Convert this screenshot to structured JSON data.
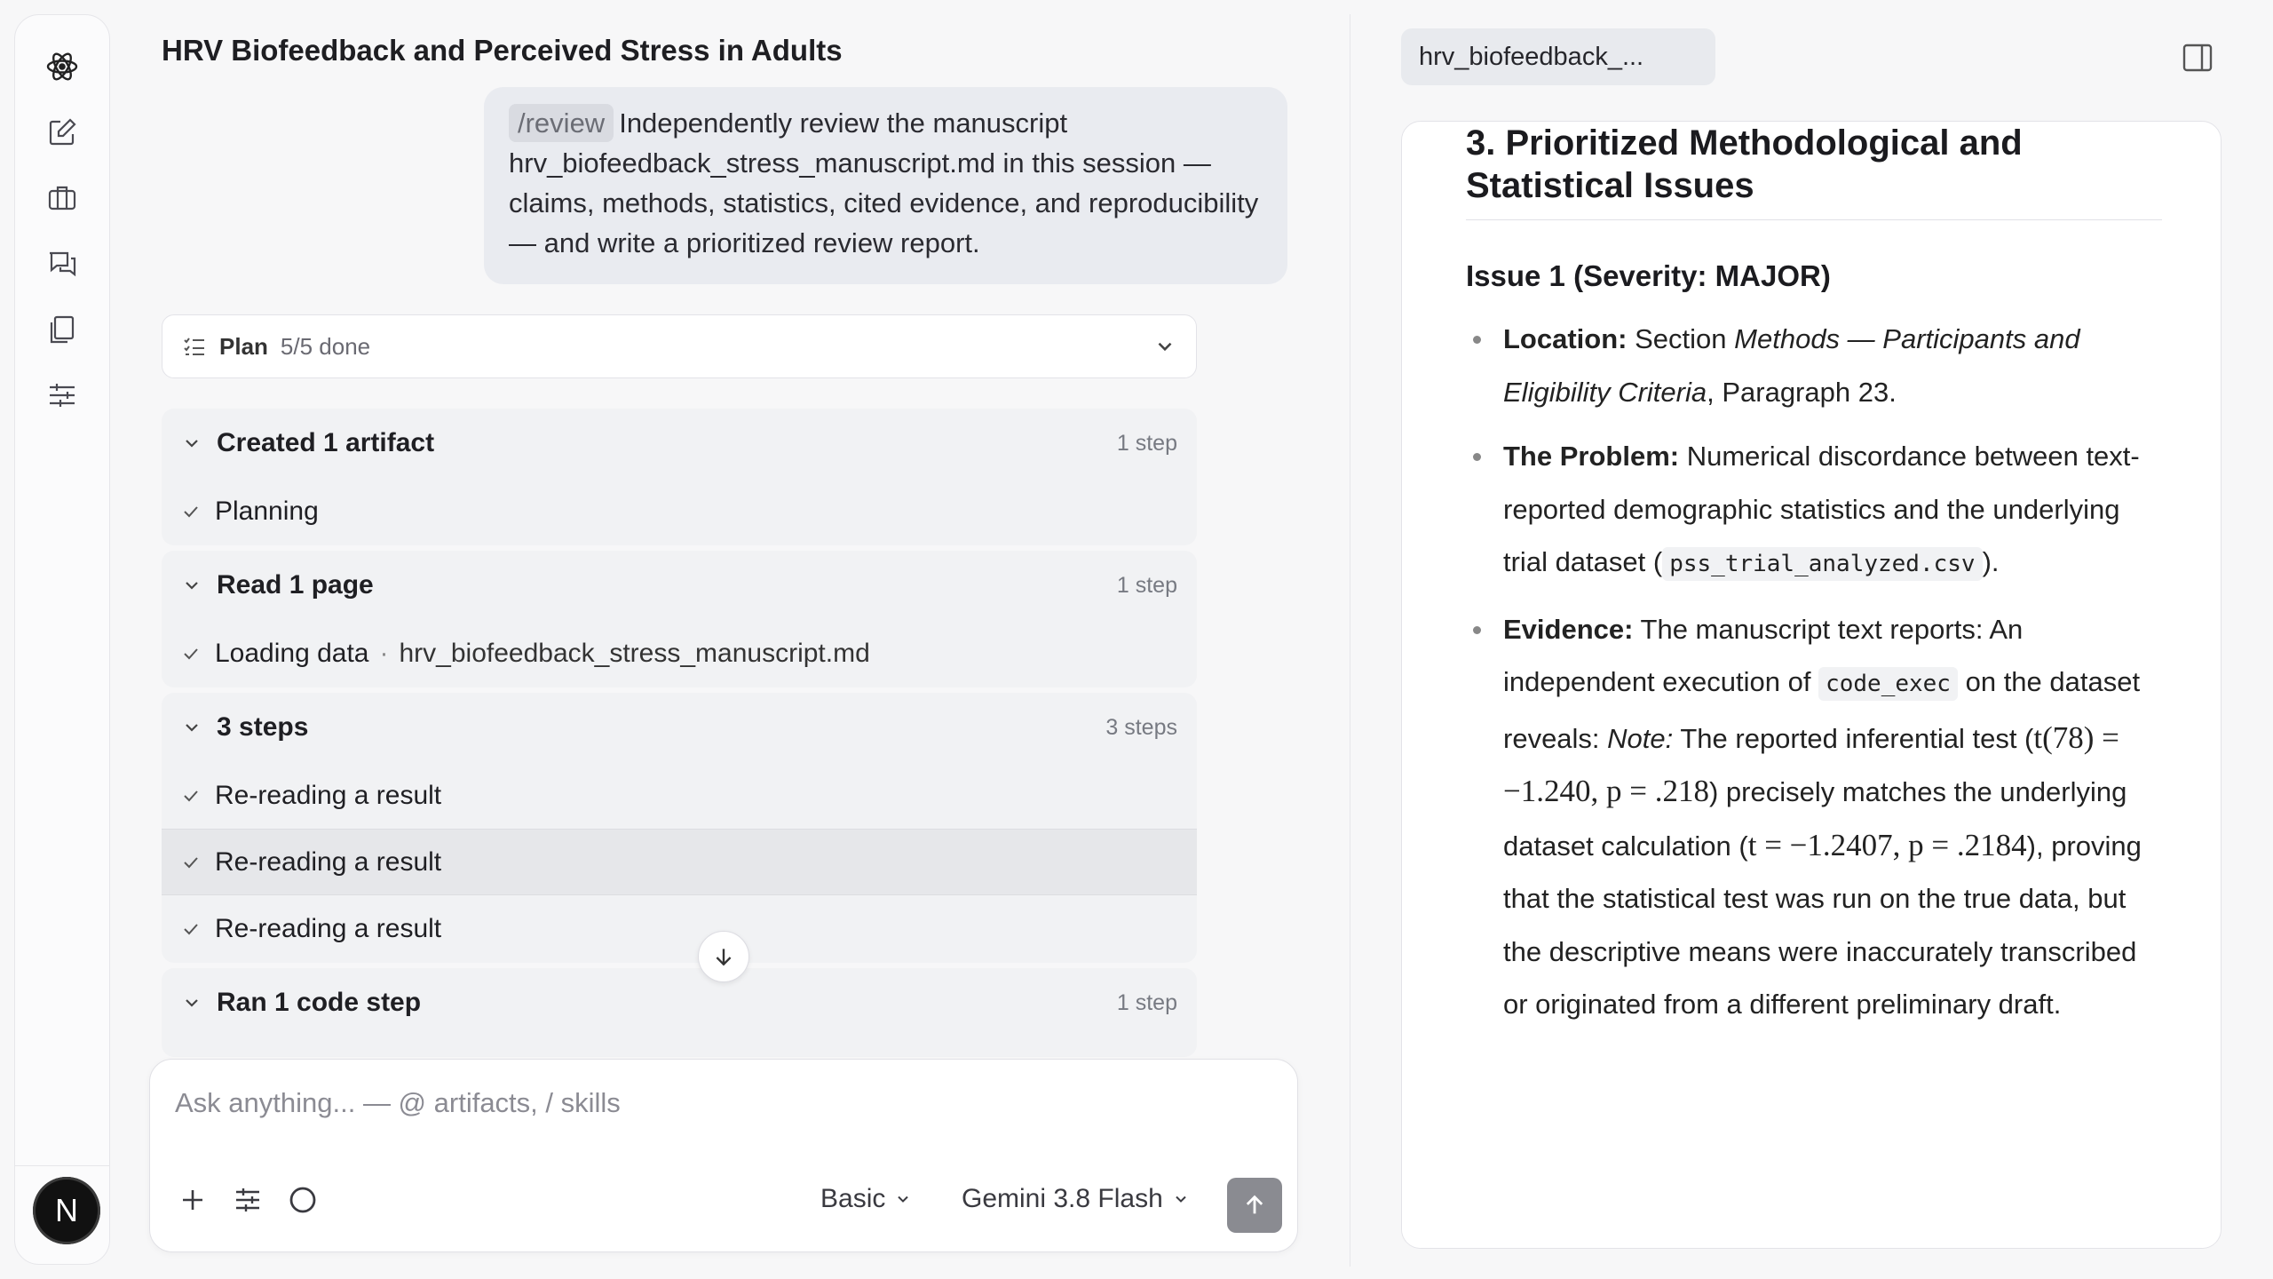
{
  "app": {
    "title": "HRV Biofeedback and Perceived Stress in Adults",
    "avatar_initial": "N"
  },
  "sidebar": {
    "icons": [
      "atom-logo-icon",
      "new-chat-icon",
      "briefcase-icon",
      "chats-icon",
      "documents-icon",
      "settings-sliders-icon"
    ]
  },
  "chat": {
    "user_message": {
      "command": "/review",
      "text": "Independently review the manuscript hrv_biofeedback_stress_manuscript.md in this session — claims, methods, statistics, cited evidence, and reproducibility — and write a prioritized review report."
    },
    "plan": {
      "label": "Plan",
      "status": "5/5 done"
    },
    "groups": [
      {
        "title": "Created 1 artifact",
        "steps": "1 step",
        "items": [
          {
            "label": "Planning"
          }
        ]
      },
      {
        "title": "Read 1 page",
        "steps": "1 step",
        "items": [
          {
            "label": "Loading data",
            "detail": "hrv_biofeedback_stress_manuscript.md"
          }
        ]
      },
      {
        "title": "3 steps",
        "steps": "3 steps",
        "items": [
          {
            "label": "Re-reading a result"
          },
          {
            "label": "Re-reading a result"
          },
          {
            "label": "Re-reading a result"
          }
        ]
      },
      {
        "title": "Ran 1 code step",
        "steps": "1 step",
        "items": []
      }
    ]
  },
  "composer": {
    "placeholder": "Ask anything... — @ artifacts, / skills",
    "mode": "Basic",
    "model": "Gemini 3.8 Flash"
  },
  "artifact": {
    "tab_label": "hrv_biofeedback_...",
    "section_title": "3. Prioritized Methodological and Statistical Issues",
    "issue_title": "Issue 1 (Severity: MAJOR)",
    "location_label": "Location:",
    "location_pre": "Section",
    "location_section": "Methods — Participants and Eligibility Criteria",
    "location_post": ", Paragraph 23.",
    "problem_label": "The Problem:",
    "problem_text": "Numerical discordance between text-reported demographic statistics and the underlying trial dataset (",
    "problem_file": "pss_trial_analyzed.csv",
    "problem_end": ").",
    "evidence_label": "Evidence:",
    "evidence_1": "The manuscript text reports: An independent execution of",
    "evidence_code": "code_exec",
    "evidence_2": "on the dataset reveals:",
    "evidence_note": "Note:",
    "evidence_3": "The reported inferential test (",
    "evidence_math_1": "t(78) = −1.240, p = .218",
    "evidence_4": ") precisely matches the underlying dataset calculation (",
    "evidence_math_2": "t = −1.2407, p = .2184",
    "evidence_5": "), proving that the statistical test was run on the true data, but the descriptive means were inaccurately transcribed or originated from a different preliminary draft."
  },
  "colors": {
    "accent_send": "#8a8b91",
    "bubble": "#e9ebf0"
  }
}
